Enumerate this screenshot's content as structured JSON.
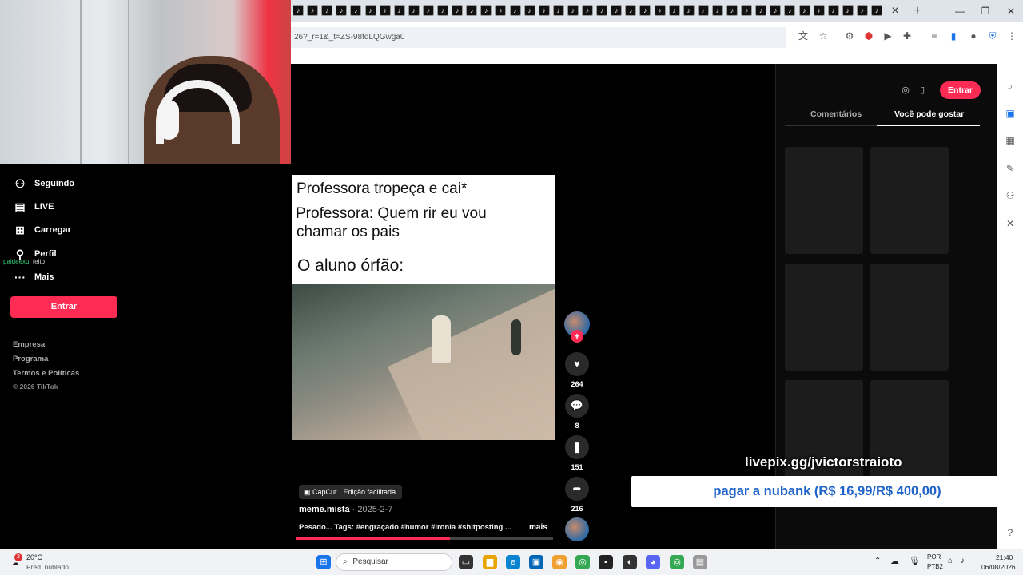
{
  "browser": {
    "tab_icon": "♪",
    "url": "26?_r=1&_t=ZS-98fdLQGwga0",
    "new_tab": "+",
    "close_tab": "×",
    "minimize": "—",
    "restore": "❐",
    "close_window": "✕"
  },
  "sidebar": {
    "items": [
      {
        "label": "Seguindo",
        "icon": "⚇"
      },
      {
        "label": "LIVE",
        "icon": "▤"
      },
      {
        "label": "Carregar",
        "icon": "⊞"
      },
      {
        "label": "Perfil",
        "icon": "⚲"
      },
      {
        "label": "Mais",
        "icon": "···"
      }
    ],
    "chat_user": "paideexu",
    "chat_text": ": feito",
    "login_button": "Entrar",
    "footer": [
      "Empresa",
      "Programa",
      "Termos e Políticas",
      "© 2026 TikTok"
    ]
  },
  "video": {
    "caption_lines": [
      "Professora tropeça e cai*",
      "Professora: Quem rir eu vou",
      "chamar os pais",
      "O aluno órfão:"
    ],
    "capcut_label": "CapCut · Edição facilitada",
    "author": "meme.mista",
    "date": " · 2025-2-7",
    "description": "Pesado... Tags: #engraçado #humor #ironia #shitposting ...",
    "more": "mais",
    "progress": 0.6
  },
  "actions": {
    "likes": "264",
    "comments": "8",
    "saves": "151",
    "shares": "216",
    "follow": "+"
  },
  "right_panel": {
    "login_button": "Entrar",
    "tabs": [
      "Comentários",
      "Você pode gostar"
    ],
    "active_tab": 1
  },
  "overlay": {
    "livepix": "livepix.gg/jvictorstraioto",
    "donation": "pagar a nubank (R$ 16,99/R$ 400,00)"
  },
  "taskbar": {
    "weather_temp": "20°C",
    "weather_desc": "Pred. nublado",
    "weather_badge": "2",
    "search_placeholder": "Pesquisar",
    "lang": "POR",
    "layout": "PTB2",
    "time": "21:40",
    "date": "06/08/2026"
  },
  "colors": {
    "accent": "#fe2c55",
    "nubank_text": "#1e63c9"
  }
}
